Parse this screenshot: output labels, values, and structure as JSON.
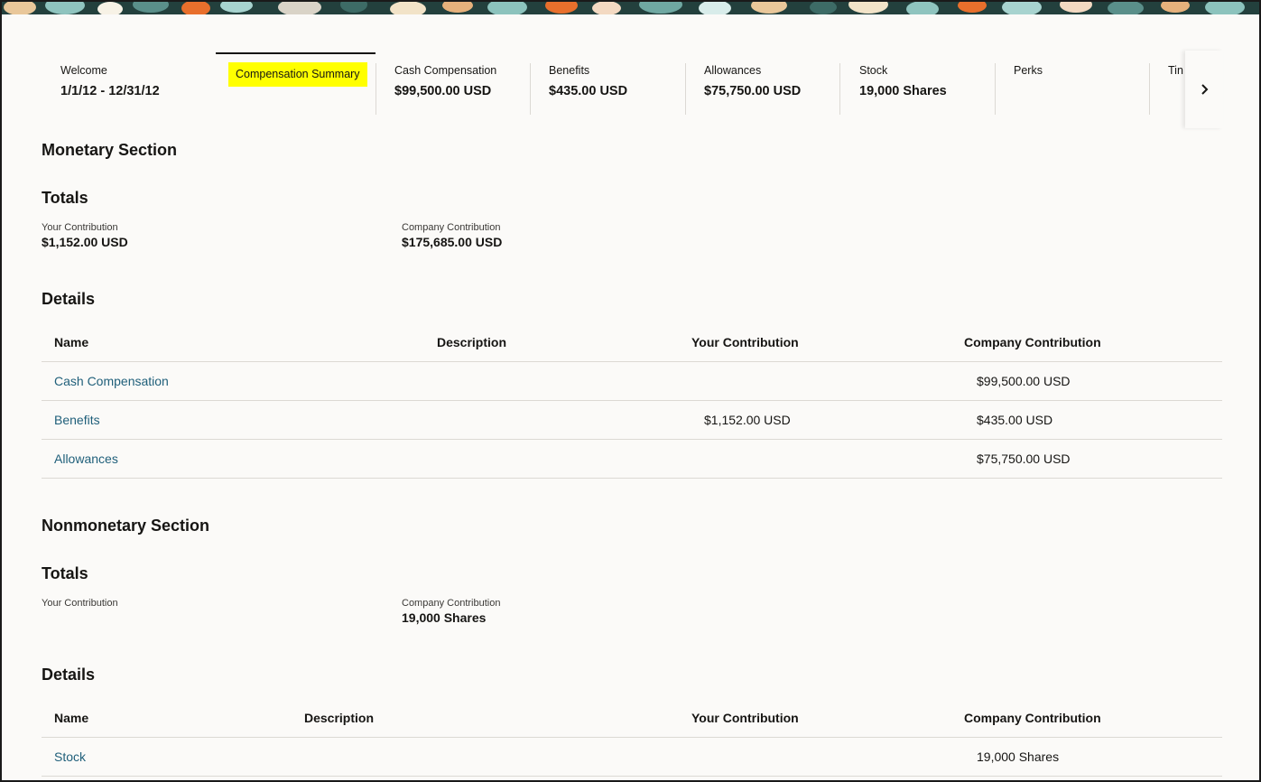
{
  "tabs": [
    {
      "label": "Welcome",
      "value": "1/1/12 - 12/31/12"
    },
    {
      "label": "Compensation Summary",
      "value": ""
    },
    {
      "label": "Cash Compensation",
      "value": "$99,500.00 USD"
    },
    {
      "label": "Benefits",
      "value": "$435.00 USD"
    },
    {
      "label": "Allowances",
      "value": "$75,750.00 USD"
    },
    {
      "label": "Stock",
      "value": "19,000 Shares"
    },
    {
      "label": "Perks",
      "value": ""
    },
    {
      "label": "Tin",
      "value": ""
    }
  ],
  "monetary": {
    "title": "Monetary Section",
    "totals_title": "Totals",
    "your_label": "Your Contribution",
    "your_value": "$1,152.00 USD",
    "company_label": "Company Contribution",
    "company_value": "$175,685.00 USD",
    "details_title": "Details",
    "columns": [
      "Name",
      "Description",
      "Your Contribution",
      "Company Contribution"
    ],
    "rows": [
      {
        "name": "Cash Compensation",
        "description": "",
        "your": "",
        "company": "$99,500.00 USD"
      },
      {
        "name": "Benefits",
        "description": "",
        "your": "$1,152.00 USD",
        "company": "$435.00 USD"
      },
      {
        "name": "Allowances",
        "description": "",
        "your": "",
        "company": "$75,750.00 USD"
      }
    ]
  },
  "nonmonetary": {
    "title": "Nonmonetary Section",
    "totals_title": "Totals",
    "your_label": "Your Contribution",
    "your_value": "",
    "company_label": "Company Contribution",
    "company_value": "19,000 Shares",
    "details_title": "Details",
    "columns": [
      "Name",
      "Description",
      "Your Contribution",
      "Company Contribution"
    ],
    "rows": [
      {
        "name": "Stock",
        "description": "",
        "your": "",
        "company": "19,000 Shares"
      }
    ]
  },
  "icons": {
    "next": "chevron-right-icon"
  },
  "colors": {
    "selected_highlight": "#ffff00",
    "link": "#1f5f7a"
  }
}
